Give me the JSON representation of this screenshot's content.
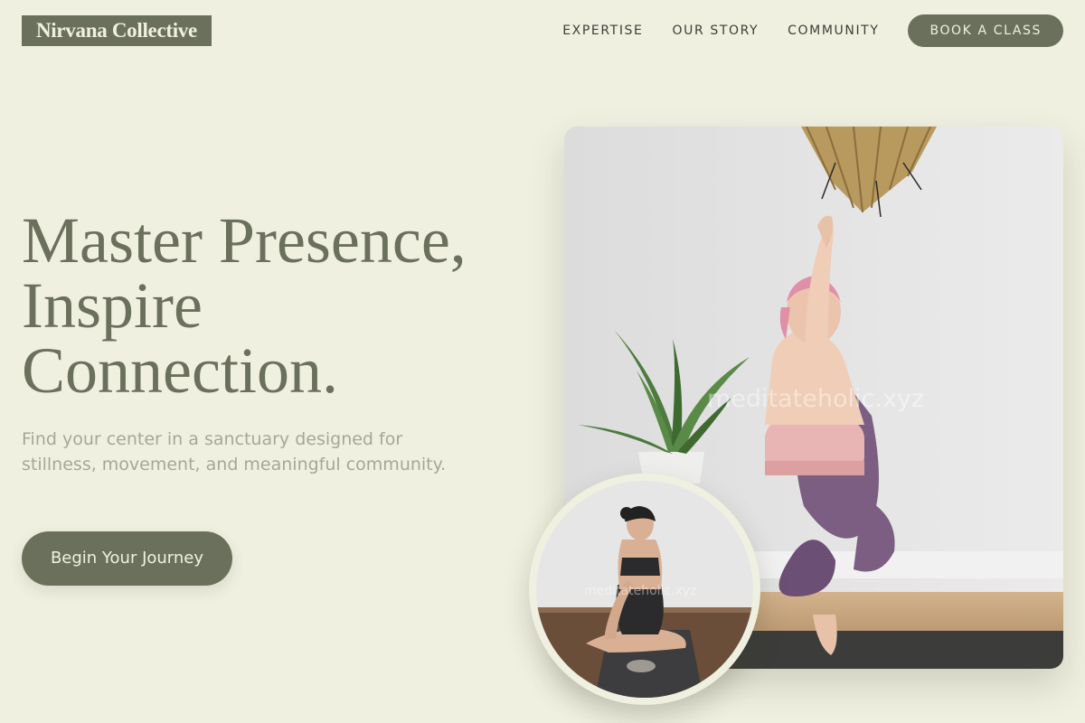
{
  "brand": {
    "name": "Nirvana Collective"
  },
  "nav": {
    "links": [
      "EXPERTISE",
      "OUR STORY",
      "COMMUNITY"
    ],
    "cta_label": "BOOK A CLASS"
  },
  "hero": {
    "headline_lines": [
      "Master Presence,",
      "Inspire",
      "Connection."
    ],
    "subtext": "Find your center in a sanctuary designed for stillness, movement, and meaningful community.",
    "cta_label": "Begin Your Journey"
  },
  "images": {
    "main_watermark": "meditateholic.xyz",
    "thumb_watermark": "meditateholic.xyz"
  },
  "colors": {
    "background": "#f0f0e1",
    "accent": "#6b705c",
    "muted_text": "#a5a895"
  },
  "icons": [
    "hanging-plant",
    "aloe-plant"
  ]
}
